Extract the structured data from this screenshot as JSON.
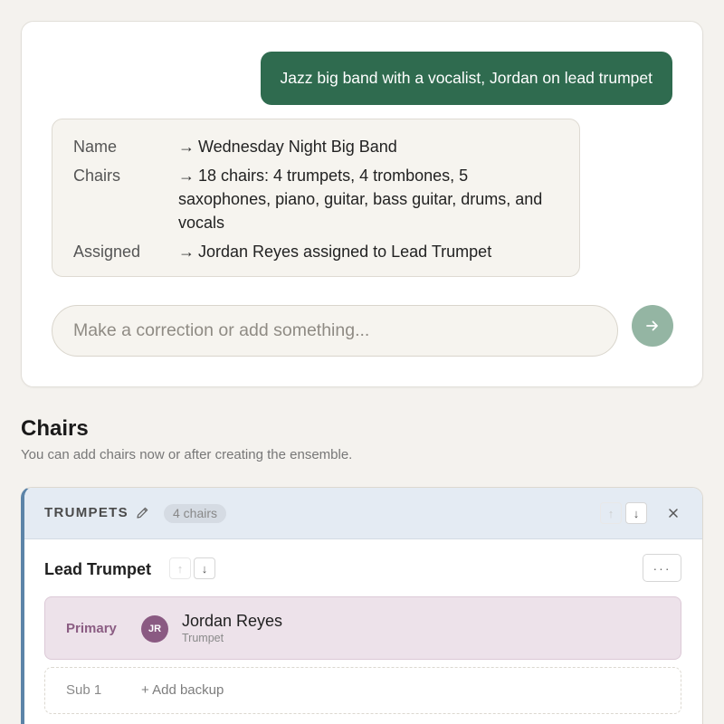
{
  "chat": {
    "user_message": "Jazz big band with a vocalist, Jordan on lead trumpet",
    "summary": [
      {
        "key": "Name",
        "arrow": "→",
        "value": "Wednesday Night Big Band"
      },
      {
        "key": "Chairs",
        "arrow": "→",
        "value": "18 chairs: 4 trumpets, 4 trombones, 5 saxophones, piano, guitar, bass guitar, drums, and vocals"
      },
      {
        "key": "Assigned",
        "arrow": "→",
        "value": "Jordan Reyes assigned to Lead Trumpet"
      }
    ],
    "input_placeholder": "Make a correction or add something...",
    "send_icon": "arrow-right-icon"
  },
  "chairs": {
    "title": "Chairs",
    "subtitle": "You can add chairs now or after creating the ensemble.",
    "section": {
      "name": "TRUMPETS",
      "count": "4 chairs",
      "chair": {
        "title": "Lead Trumpet",
        "more_label": "···",
        "primary": {
          "role": "Primary",
          "initials": "JR",
          "name": "Jordan Reyes",
          "instrument": "Trumpet"
        },
        "sub": {
          "role": "Sub 1",
          "add_label": "+ Add backup"
        }
      }
    }
  },
  "colors": {
    "user_bubble": "#2f6b4f",
    "send_button": "#94b5a3",
    "section_accent": "#5c84a8",
    "primary_bg": "#ede2ea",
    "avatar": "#8a5a82"
  }
}
